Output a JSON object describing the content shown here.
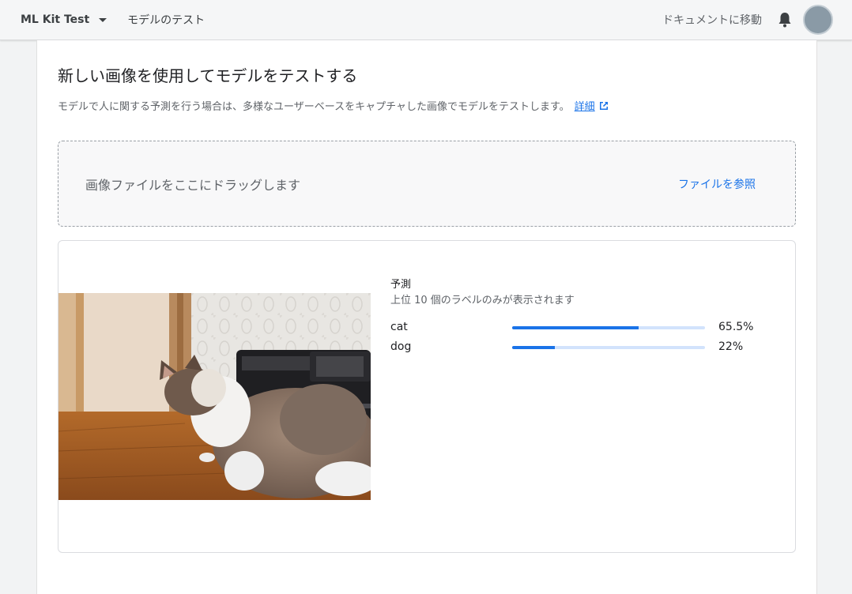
{
  "header": {
    "project_name": "ML Kit Test",
    "page_name": "モデルのテスト",
    "docs_link": "ドキュメントに移動"
  },
  "main": {
    "title": "新しい画像を使用してモデルをテストする",
    "description": "モデルで人に関する予測を行う場合は、多様なユーザーベースをキャプチャした画像でモデルをテストします。",
    "learn_more": "詳細",
    "dropzone_text": "画像ファイルをここにドラッグします",
    "browse_button": "ファイルを参照"
  },
  "predictions": {
    "title": "予測",
    "subtitle": "上位 10 個のラベルのみが表示されます",
    "items": [
      {
        "label": "cat",
        "value_text": "65.5%",
        "fraction": 0.655
      },
      {
        "label": "dog",
        "value_text": "22%",
        "fraction": 0.22
      }
    ]
  },
  "colors": {
    "accent": "#1a73e8",
    "track": "#d2e3fc"
  },
  "icons": [
    "dropdown-caret-icon",
    "bell-icon",
    "external-link-icon"
  ]
}
